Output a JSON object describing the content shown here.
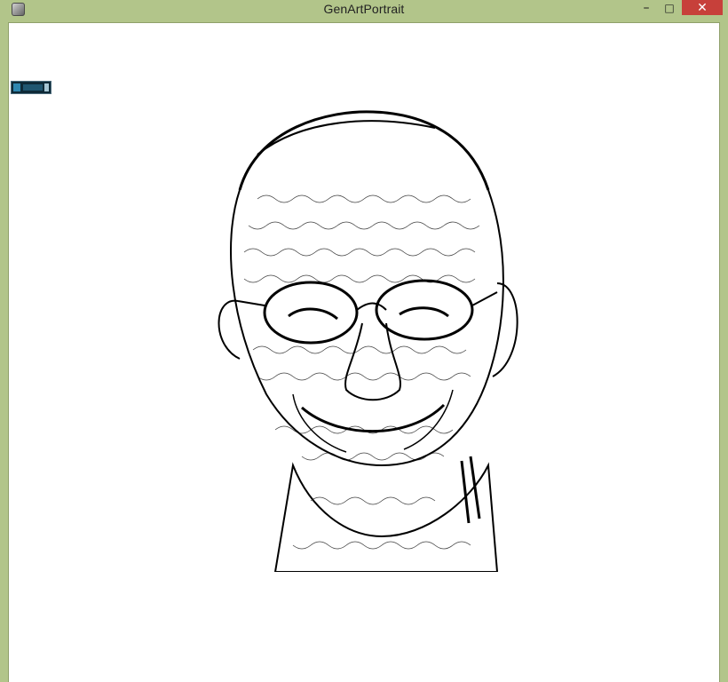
{
  "window": {
    "title": "GenArtPortrait",
    "icon": "app-window-icon",
    "controls": {
      "minimize": "–",
      "maximize": "□",
      "close": "✕"
    }
  },
  "canvas": {
    "image_description_icon": "line-art-portrait"
  }
}
